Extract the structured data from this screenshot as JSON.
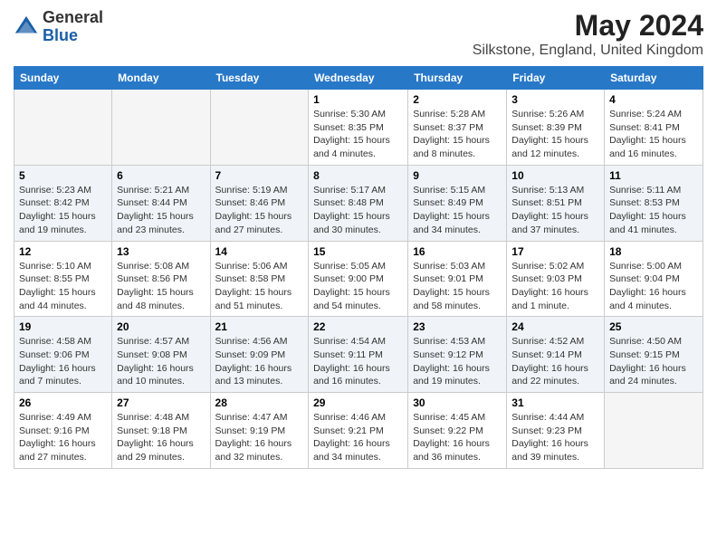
{
  "logo": {
    "general": "General",
    "blue": "Blue"
  },
  "title": "May 2024",
  "subtitle": "Silkstone, England, United Kingdom",
  "days_of_week": [
    "Sunday",
    "Monday",
    "Tuesday",
    "Wednesday",
    "Thursday",
    "Friday",
    "Saturday"
  ],
  "weeks": [
    [
      {
        "num": "",
        "sunrise": "",
        "sunset": "",
        "daylight": ""
      },
      {
        "num": "",
        "sunrise": "",
        "sunset": "",
        "daylight": ""
      },
      {
        "num": "",
        "sunrise": "",
        "sunset": "",
        "daylight": ""
      },
      {
        "num": "1",
        "sunrise": "Sunrise: 5:30 AM",
        "sunset": "Sunset: 8:35 PM",
        "daylight": "Daylight: 15 hours and 4 minutes."
      },
      {
        "num": "2",
        "sunrise": "Sunrise: 5:28 AM",
        "sunset": "Sunset: 8:37 PM",
        "daylight": "Daylight: 15 hours and 8 minutes."
      },
      {
        "num": "3",
        "sunrise": "Sunrise: 5:26 AM",
        "sunset": "Sunset: 8:39 PM",
        "daylight": "Daylight: 15 hours and 12 minutes."
      },
      {
        "num": "4",
        "sunrise": "Sunrise: 5:24 AM",
        "sunset": "Sunset: 8:41 PM",
        "daylight": "Daylight: 15 hours and 16 minutes."
      }
    ],
    [
      {
        "num": "5",
        "sunrise": "Sunrise: 5:23 AM",
        "sunset": "Sunset: 8:42 PM",
        "daylight": "Daylight: 15 hours and 19 minutes."
      },
      {
        "num": "6",
        "sunrise": "Sunrise: 5:21 AM",
        "sunset": "Sunset: 8:44 PM",
        "daylight": "Daylight: 15 hours and 23 minutes."
      },
      {
        "num": "7",
        "sunrise": "Sunrise: 5:19 AM",
        "sunset": "Sunset: 8:46 PM",
        "daylight": "Daylight: 15 hours and 27 minutes."
      },
      {
        "num": "8",
        "sunrise": "Sunrise: 5:17 AM",
        "sunset": "Sunset: 8:48 PM",
        "daylight": "Daylight: 15 hours and 30 minutes."
      },
      {
        "num": "9",
        "sunrise": "Sunrise: 5:15 AM",
        "sunset": "Sunset: 8:49 PM",
        "daylight": "Daylight: 15 hours and 34 minutes."
      },
      {
        "num": "10",
        "sunrise": "Sunrise: 5:13 AM",
        "sunset": "Sunset: 8:51 PM",
        "daylight": "Daylight: 15 hours and 37 minutes."
      },
      {
        "num": "11",
        "sunrise": "Sunrise: 5:11 AM",
        "sunset": "Sunset: 8:53 PM",
        "daylight": "Daylight: 15 hours and 41 minutes."
      }
    ],
    [
      {
        "num": "12",
        "sunrise": "Sunrise: 5:10 AM",
        "sunset": "Sunset: 8:55 PM",
        "daylight": "Daylight: 15 hours and 44 minutes."
      },
      {
        "num": "13",
        "sunrise": "Sunrise: 5:08 AM",
        "sunset": "Sunset: 8:56 PM",
        "daylight": "Daylight: 15 hours and 48 minutes."
      },
      {
        "num": "14",
        "sunrise": "Sunrise: 5:06 AM",
        "sunset": "Sunset: 8:58 PM",
        "daylight": "Daylight: 15 hours and 51 minutes."
      },
      {
        "num": "15",
        "sunrise": "Sunrise: 5:05 AM",
        "sunset": "Sunset: 9:00 PM",
        "daylight": "Daylight: 15 hours and 54 minutes."
      },
      {
        "num": "16",
        "sunrise": "Sunrise: 5:03 AM",
        "sunset": "Sunset: 9:01 PM",
        "daylight": "Daylight: 15 hours and 58 minutes."
      },
      {
        "num": "17",
        "sunrise": "Sunrise: 5:02 AM",
        "sunset": "Sunset: 9:03 PM",
        "daylight": "Daylight: 16 hours and 1 minute."
      },
      {
        "num": "18",
        "sunrise": "Sunrise: 5:00 AM",
        "sunset": "Sunset: 9:04 PM",
        "daylight": "Daylight: 16 hours and 4 minutes."
      }
    ],
    [
      {
        "num": "19",
        "sunrise": "Sunrise: 4:58 AM",
        "sunset": "Sunset: 9:06 PM",
        "daylight": "Daylight: 16 hours and 7 minutes."
      },
      {
        "num": "20",
        "sunrise": "Sunrise: 4:57 AM",
        "sunset": "Sunset: 9:08 PM",
        "daylight": "Daylight: 16 hours and 10 minutes."
      },
      {
        "num": "21",
        "sunrise": "Sunrise: 4:56 AM",
        "sunset": "Sunset: 9:09 PM",
        "daylight": "Daylight: 16 hours and 13 minutes."
      },
      {
        "num": "22",
        "sunrise": "Sunrise: 4:54 AM",
        "sunset": "Sunset: 9:11 PM",
        "daylight": "Daylight: 16 hours and 16 minutes."
      },
      {
        "num": "23",
        "sunrise": "Sunrise: 4:53 AM",
        "sunset": "Sunset: 9:12 PM",
        "daylight": "Daylight: 16 hours and 19 minutes."
      },
      {
        "num": "24",
        "sunrise": "Sunrise: 4:52 AM",
        "sunset": "Sunset: 9:14 PM",
        "daylight": "Daylight: 16 hours and 22 minutes."
      },
      {
        "num": "25",
        "sunrise": "Sunrise: 4:50 AM",
        "sunset": "Sunset: 9:15 PM",
        "daylight": "Daylight: 16 hours and 24 minutes."
      }
    ],
    [
      {
        "num": "26",
        "sunrise": "Sunrise: 4:49 AM",
        "sunset": "Sunset: 9:16 PM",
        "daylight": "Daylight: 16 hours and 27 minutes."
      },
      {
        "num": "27",
        "sunrise": "Sunrise: 4:48 AM",
        "sunset": "Sunset: 9:18 PM",
        "daylight": "Daylight: 16 hours and 29 minutes."
      },
      {
        "num": "28",
        "sunrise": "Sunrise: 4:47 AM",
        "sunset": "Sunset: 9:19 PM",
        "daylight": "Daylight: 16 hours and 32 minutes."
      },
      {
        "num": "29",
        "sunrise": "Sunrise: 4:46 AM",
        "sunset": "Sunset: 9:21 PM",
        "daylight": "Daylight: 16 hours and 34 minutes."
      },
      {
        "num": "30",
        "sunrise": "Sunrise: 4:45 AM",
        "sunset": "Sunset: 9:22 PM",
        "daylight": "Daylight: 16 hours and 36 minutes."
      },
      {
        "num": "31",
        "sunrise": "Sunrise: 4:44 AM",
        "sunset": "Sunset: 9:23 PM",
        "daylight": "Daylight: 16 hours and 39 minutes."
      },
      {
        "num": "",
        "sunrise": "",
        "sunset": "",
        "daylight": ""
      }
    ]
  ]
}
